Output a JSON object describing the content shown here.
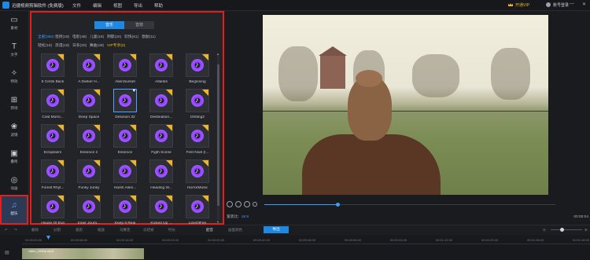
{
  "titlebar": {
    "app_title": "迅捷视频剪辑软件 (免费版)",
    "menu": [
      "文件",
      "编辑",
      "视图",
      "导出",
      "帮助"
    ],
    "vip_label": "开通VIP",
    "login_label": "账号登录"
  },
  "sidebar": {
    "items": [
      {
        "icon": "media-icon",
        "label": "素材"
      },
      {
        "icon": "text-icon",
        "label": "文字"
      },
      {
        "icon": "effects-icon",
        "label": "特效"
      },
      {
        "icon": "transition-icon",
        "label": "转场"
      },
      {
        "icon": "filter-icon",
        "label": "滤镜"
      },
      {
        "icon": "overlay-icon",
        "label": "叠附"
      },
      {
        "icon": "animation-icon",
        "label": "动画"
      },
      {
        "icon": "music-note-icon",
        "label": "配乐",
        "active": true
      }
    ]
  },
  "panel": {
    "tabs": [
      {
        "label": "音乐",
        "active": true
      },
      {
        "label": "音效",
        "active": false
      }
    ],
    "categories": [
      [
        {
          "label": "全部(350)",
          "active": true
        },
        {
          "label": "悠扬(18)"
        },
        {
          "label": "电影(48)"
        },
        {
          "label": "儿童(18)"
        },
        {
          "label": "阴郁(20)"
        },
        {
          "label": "欢快(61)"
        },
        {
          "label": "激励(11)"
        }
      ],
      [
        {
          "label": "轻松(18)"
        },
        {
          "label": "浪漫(18)"
        },
        {
          "label": "日系(20)"
        },
        {
          "label": "舞曲(48)"
        },
        {
          "label": "VIP专享(0)",
          "vip": true
        }
      ]
    ],
    "tracks": [
      {
        "name": "5 Cents Back",
        "vip": true
      },
      {
        "name": "A Darker H...",
        "vip": true
      },
      {
        "name": "AlienSunset",
        "vip": true
      },
      {
        "name": "Atlantis",
        "vip": true
      },
      {
        "name": "Beginning",
        "vip": true
      },
      {
        "name": "Cold Morni...",
        "vip": true
      },
      {
        "name": "Deep Space",
        "vip": true
      },
      {
        "name": "Delusion 32",
        "vip": false,
        "selected": true
      },
      {
        "name": "Destination...",
        "vip": true
      },
      {
        "name": "Drifting2",
        "vip": true
      },
      {
        "name": "Ectoplasm",
        "vip": true
      },
      {
        "name": "Essence 2",
        "vip": true
      },
      {
        "name": "Essence",
        "vip": true
      },
      {
        "name": "Figth Scene",
        "vip": true
      },
      {
        "name": "First Noel (I...",
        "vip": true
      },
      {
        "name": "Forest Rhyt...",
        "vip": true
      },
      {
        "name": "Funky Junky",
        "vip": true
      },
      {
        "name": "Harsh Alien...",
        "vip": true
      },
      {
        "name": "Heading W...",
        "vip": true
      },
      {
        "name": "HorrorMusic",
        "vip": true
      },
      {
        "name": "House Of Evil",
        "vip": true
      },
      {
        "name": "Inner Journ...",
        "vip": true
      },
      {
        "name": "Keep It Real",
        "vip": true
      },
      {
        "name": "Kicked Up ...",
        "vip": true
      },
      {
        "name": "LineOfFire",
        "vip": true
      }
    ]
  },
  "preview": {
    "ratio_label": "宽高比:",
    "ratio_value": "16:9",
    "time": "00:00:04",
    "progress_fraction": 0.25
  },
  "toolbar": {
    "items": [
      "撤销",
      "重做",
      "删除",
      "分割",
      "裁剪",
      "缩放",
      "马赛克",
      "冻结帧",
      "时长",
      "配音",
      "画面调色",
      "导出"
    ],
    "export_label": "导出"
  },
  "timeline": {
    "ticks": [
      "00:00:00.00",
      "00:00:08.00",
      "00:00:16.00",
      "00:00:24.00",
      "00:00:32.00",
      "00:00:40.00",
      "00:00:48.00",
      "00:00:56.00",
      "00:01:04.00",
      "00:01:12.00",
      "00:01:20.00",
      "00:01:28.00",
      "00:01:36.00"
    ],
    "clip_label": "video_1080p.mp4"
  }
}
